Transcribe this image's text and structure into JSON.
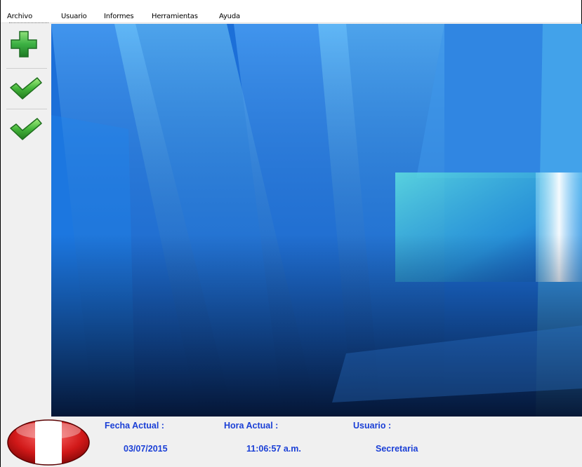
{
  "menu": {
    "items": [
      {
        "label": "Archivo"
      },
      {
        "label": "Usuario"
      },
      {
        "label": "Informes"
      },
      {
        "label": "Herramientas"
      },
      {
        "label": "Ayuda"
      }
    ]
  },
  "toolbar": {
    "buttons": [
      {
        "icon": "plus-icon"
      },
      {
        "icon": "check-icon"
      },
      {
        "icon": "check-icon"
      }
    ]
  },
  "status": {
    "date_label": "Fecha Actual :",
    "date_value": "03/07/2015",
    "time_label": "Hora Actual :",
    "time_value": "11:06:57 a.m.",
    "user_label": "Usuario :",
    "user_value": "Secretaria"
  },
  "colors": {
    "status_text": "#1a3fd6",
    "plus_green": "#3cb043",
    "check_green": "#44b53a",
    "flag_red": "#d01818"
  }
}
